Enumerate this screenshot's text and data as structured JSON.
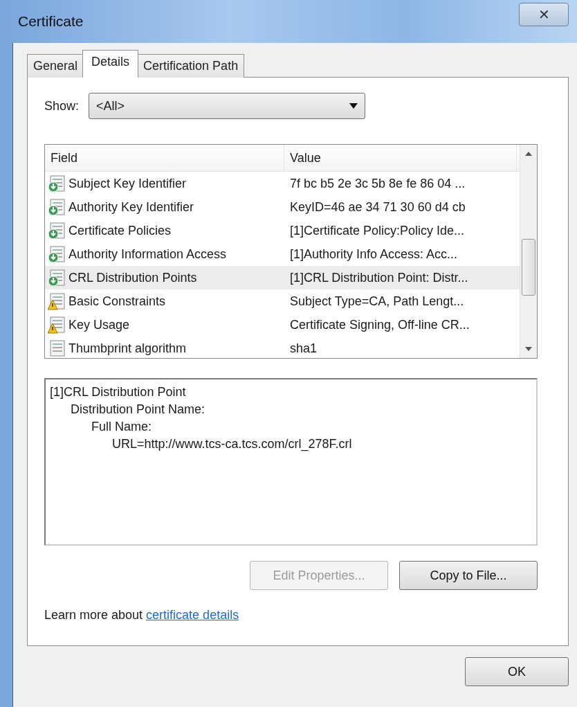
{
  "window": {
    "title": "Certificate",
    "close": "✕"
  },
  "tabs": [
    {
      "label": "General",
      "selected": false
    },
    {
      "label": "Details",
      "selected": true
    },
    {
      "label": "Certification Path",
      "selected": false
    }
  ],
  "show": {
    "label": "Show:",
    "value": "<All>"
  },
  "table": {
    "columns": [
      "Field",
      "Value"
    ],
    "rows": [
      {
        "kind": "info",
        "field": "Subject Key Identifier",
        "value": "7f bc b5 2e 3c 5b 8e fe 86 04 ...",
        "selected": false
      },
      {
        "kind": "info",
        "field": "Authority Key Identifier",
        "value": "KeyID=46 ae 34 71 30 60 d4 cb",
        "selected": false
      },
      {
        "kind": "info",
        "field": "Certificate Policies",
        "value": "[1]Certificate Policy:Policy Ide...",
        "selected": false
      },
      {
        "kind": "info",
        "field": "Authority Information Access",
        "value": "[1]Authority Info Access: Acc...",
        "selected": false
      },
      {
        "kind": "info",
        "field": "CRL Distribution Points",
        "value": "[1]CRL Distribution Point: Distr...",
        "selected": true
      },
      {
        "kind": "warning",
        "field": "Basic Constraints",
        "value": "Subject Type=CA, Path Lengt...",
        "selected": false
      },
      {
        "kind": "warning",
        "field": "Key Usage",
        "value": "Certificate Signing, Off-line CR...",
        "selected": false
      },
      {
        "kind": "plain",
        "field": "Thumbprint algorithm",
        "value": "sha1",
        "selected": false
      }
    ]
  },
  "details": [
    "[1]CRL Distribution Point",
    "Distribution Point Name:",
    "Full Name:",
    "URL=http://www.tcs-ca.tcs.com/crl_278F.crl"
  ],
  "buttons": [
    {
      "label": "Edit Properties...",
      "disabled": true
    },
    {
      "label": "Copy to File...",
      "disabled": false
    }
  ],
  "learn_more": {
    "text": "Learn more about ",
    "link": "certificate details"
  },
  "ok": "OK"
}
